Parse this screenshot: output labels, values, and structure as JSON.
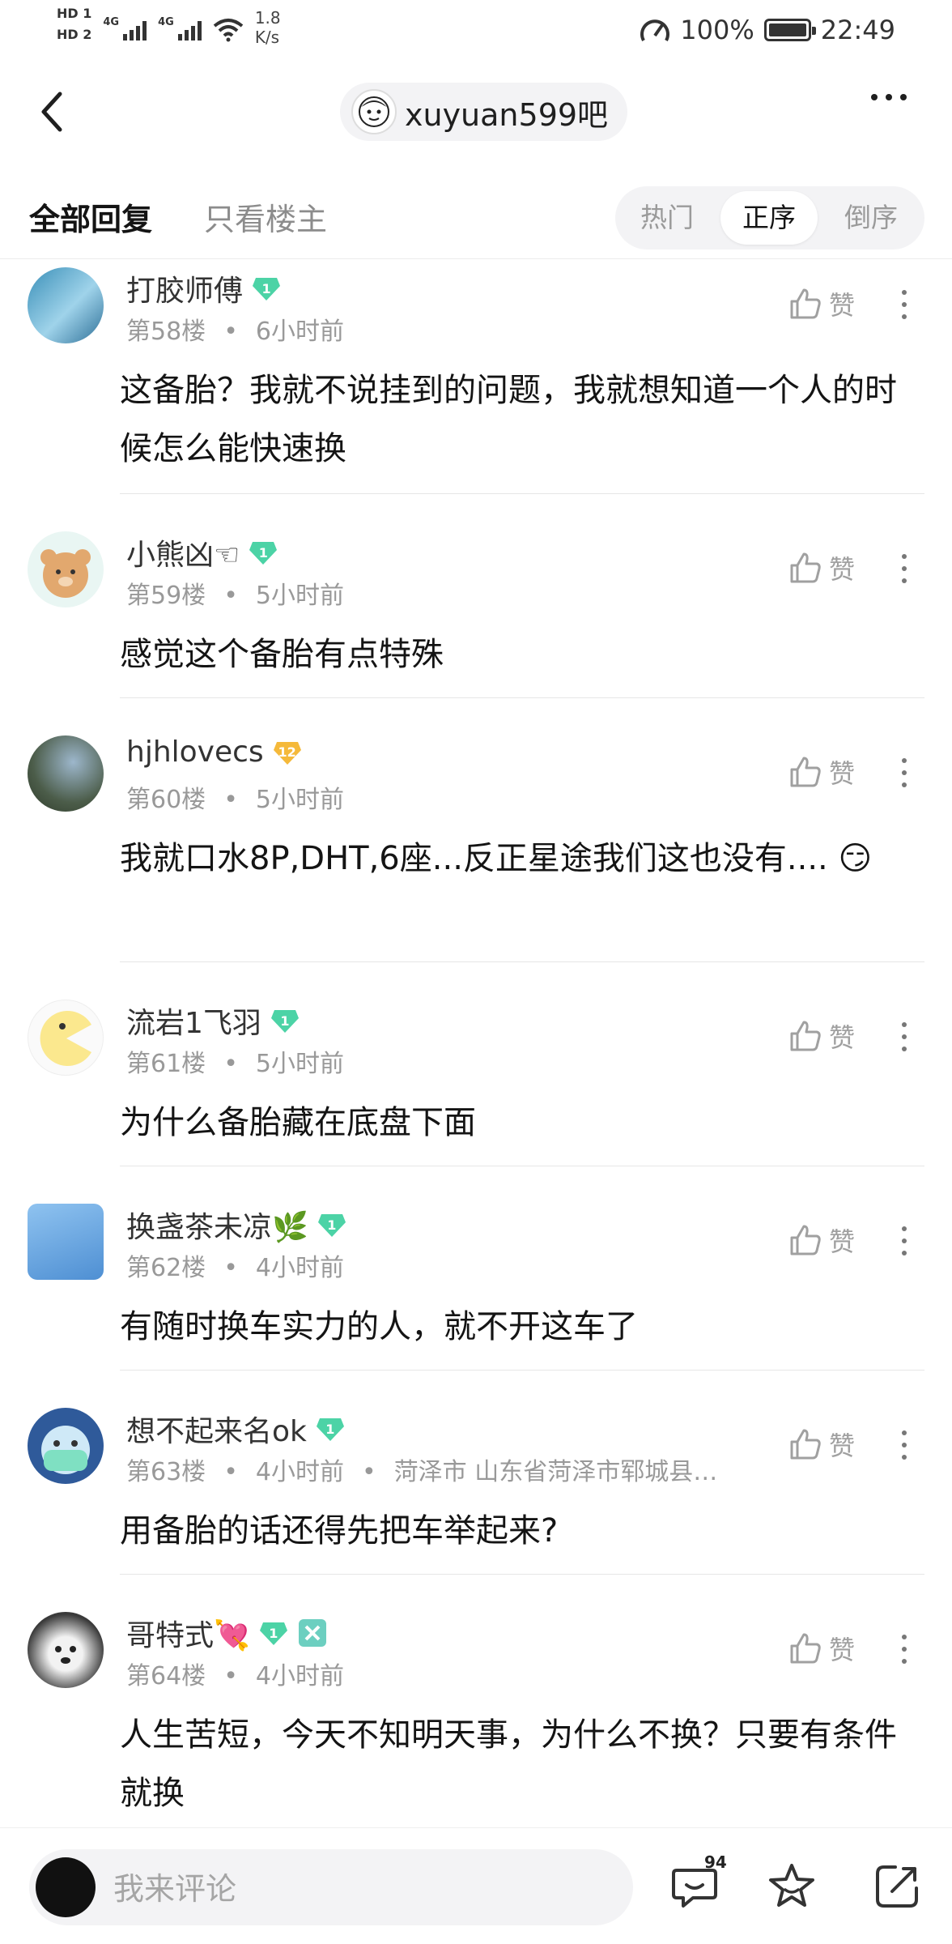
{
  "status_bar": {
    "hd1": "HD 1",
    "hd2": "HD 2",
    "net1": "4G",
    "net2": "4G",
    "speed_value": "1.8",
    "speed_unit": "K/s",
    "battery": "100%",
    "time": "22:49"
  },
  "nav": {
    "forum_name": "xuyuan599吧"
  },
  "tabs": {
    "all_replies": "全部回复",
    "op_only": "只看楼主",
    "sort_hot": "热门",
    "sort_asc": "正序",
    "sort_desc": "倒序"
  },
  "comments": [
    {
      "user": "打胶师傅",
      "level": "1",
      "floor": "第58楼",
      "time": "6小时前",
      "location": "",
      "like": "赞",
      "text": "这备胎？我就不说挂到的问题，我就想知道一个人的时候怎么能快速换"
    },
    {
      "user": "小熊凶☜",
      "level": "1",
      "floor": "第59楼",
      "time": "5小时前",
      "location": "",
      "like": "赞",
      "text": "感觉这个备胎有点特殊"
    },
    {
      "user": "hjhlovecs",
      "level": "12",
      "floor": "第60楼",
      "time": "5小时前",
      "location": "",
      "like": "赞",
      "text": "我就口水8P,DHT,6座...反正星途我们这也没有....",
      "emoji": "😏"
    },
    {
      "user": "流岩1飞羽",
      "level": "1",
      "floor": "第61楼",
      "time": "5小时前",
      "location": "",
      "like": "赞",
      "text": "为什么备胎藏在底盘下面"
    },
    {
      "user": "换盏茶未凉🌿",
      "level": "1",
      "floor": "第62楼",
      "time": "4小时前",
      "location": "",
      "like": "赞",
      "text": "有随时换车实力的人，就不开这车了"
    },
    {
      "user": "想不起来名ok",
      "level": "1",
      "floor": "第63楼",
      "time": "4小时前",
      "location": "菏泽市 山东省菏泽市郓城县…",
      "like": "赞",
      "text": "用备胎的话还得先把车举起来?"
    },
    {
      "user": "哥特式💘",
      "level": "1",
      "floor": "第64楼",
      "time": "4小时前",
      "location": "",
      "like": "赞",
      "text": "人生苦短，今天不知明天事，为什么不换？只要有条件就换"
    }
  ],
  "bottom": {
    "comment_placeholder": "我来评论",
    "comment_count": "94"
  },
  "colors": {
    "badge_green": "#4cd3a6",
    "badge_gold": "#f5b93a",
    "muted_text": "#999999"
  }
}
